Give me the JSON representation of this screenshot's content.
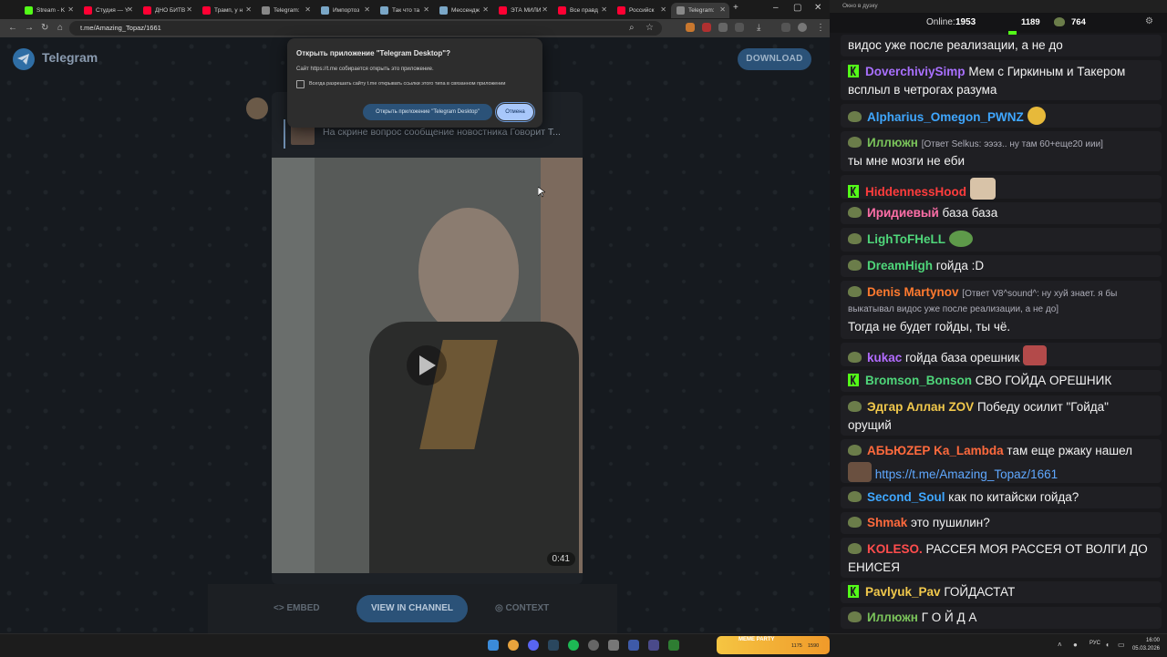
{
  "browser": {
    "tabs": [
      {
        "label": "Stream - K",
        "color": "#53fc18"
      },
      {
        "label": "Студия — Y",
        "color": "#ff0033"
      },
      {
        "label": "ДНО БИТВ",
        "color": "#ff0033"
      },
      {
        "label": "Трамп, у н",
        "color": "#ff0033"
      },
      {
        "label": "Telegram: ",
        "color": "#888888"
      },
      {
        "label": "Импортоз",
        "color": "#7aa7c7"
      },
      {
        "label": "Так что та",
        "color": "#7aa7c7"
      },
      {
        "label": "Мессендж",
        "color": "#7aa7c7"
      },
      {
        "label": "ЭТА МИЛИ",
        "color": "#ff0033"
      },
      {
        "label": "Все правд",
        "color": "#ff0033"
      },
      {
        "label": "Российск",
        "color": "#ff0033"
      },
      {
        "label": "Telegram: ",
        "color": "#888888"
      }
    ],
    "url": "t.me/Amazing_Topaz/1661"
  },
  "telegram": {
    "brand": "Telegram",
    "download_label": "DOWNLOAD",
    "reply_preview": "На скрине вопрос сообщение новостника Говорит Т...",
    "video_duration": "0:41",
    "embed_label": "EMBED",
    "view_label": "VIEW IN CHANNEL",
    "context_label": "CONTEXT"
  },
  "dialog": {
    "title": "Открыть приложение \"Telegram Desktop\"?",
    "body": "Сайт https://t.me собирается открыть это приложение.",
    "checkbox_label": "Всегда разрешать сайту t.me открывать ссылки этого типа в связанном приложении",
    "open_label": "Открыть приложение \"Telegram Desktop\"",
    "cancel_label": "Отмена"
  },
  "chat": {
    "window_title": "Окно в дуэку",
    "online_label": "Online:",
    "online_count": "1953",
    "kick_count": "1189",
    "twitch_count": "764",
    "messages": [
      {
        "badge": "none",
        "nick": "",
        "nick_color": "#ffffff",
        "text": "видос уже после реализации, а не до",
        "text2": ""
      },
      {
        "badge": "kick",
        "nick": "DoverchiviySimp",
        "nick_color": "#a970ff",
        "text": "Мем с Гиркиным и Такером",
        "text2": "всплыл в четрогах разума"
      },
      {
        "badge": "twitch",
        "nick": "Alpharius_Omegon_PWNZ",
        "nick_color": "#3fa7ff",
        "text": "",
        "text2": ""
      },
      {
        "badge": "twitch",
        "nick": "Иллюжн",
        "nick_color": "#7ac35a",
        "reply": "[Ответ Selkus: эээз.. ну там 60+еще20 иии]",
        "text": "",
        "text2": "ты мне мозги не еби"
      },
      {
        "badge": "kick",
        "nick": "HiddennessHood",
        "nick_color": "#ff3c3c",
        "text": "",
        "text2": ""
      },
      {
        "badge": "twitch",
        "nick": "Иридиевый",
        "nick_color": "#ff6fa8",
        "text": "база база",
        "text2": ""
      },
      {
        "badge": "twitch",
        "nick": "LighToFHeLL",
        "nick_color": "#4fd67a",
        "text": "",
        "text2": ""
      },
      {
        "badge": "twitch",
        "nick": "DreamHigh",
        "nick_color": "#4fd67a",
        "text": "гойда :D",
        "text2": ""
      },
      {
        "badge": "twitch",
        "nick": "Denis Martynov",
        "nick_color": "#ff7a2f",
        "reply": "[Ответ V8^sound^: ну хуй знает. я бы",
        "reply2": "выкатывал видос уже после реализации, а не до]",
        "text": "",
        "text2": "Тогда не будет гойды, ты чё."
      },
      {
        "badge": "twitch",
        "nick": "kukac",
        "nick_color": "#b26bff",
        "text": "гойда база орешник",
        "text2": ""
      },
      {
        "badge": "kick",
        "nick": "Bromson_Bonson",
        "nick_color": "#4fd67a",
        "text": "СВО ГОЙДА ОРЕШНИК",
        "text2": ""
      },
      {
        "badge": "twitch",
        "nick": "Эдгар Аллан ZOV",
        "nick_color": "#f2c94c",
        "text": "Победу осилит \"Гойда\"",
        "text2": "орущий"
      },
      {
        "badge": "twitch",
        "nick": "АБЬЮZЕР",
        "nick_color": "#ff6a3d",
        "nick2": "Ka_Lambda",
        "text": "там еще ржаку нашел",
        "text2": "https://t.me/Amazing_Topaz/1661"
      },
      {
        "badge": "twitch",
        "nick": "Second_Soul",
        "nick_color": "#3fa7ff",
        "text": "как по китайски гойда?",
        "text2": ""
      },
      {
        "badge": "twitch",
        "nick": "Shmak",
        "nick_color": "#ff6a3d",
        "text": "это пушилин?",
        "text2": ""
      },
      {
        "badge": "twitch",
        "nick": "KOLESO.",
        "nick_color": "#ff4d4d",
        "text": "РАССЕЯ МОЯ РАССЕЯ ОТ ВОЛГИ ДО",
        "text2": "ЕНИСЕЯ"
      },
      {
        "badge": "kick",
        "nick": "Pavlyuk_Pav",
        "nick_color": "#f2c94c",
        "text": "ГОЙДАСТАТ",
        "text2": ""
      },
      {
        "badge": "twitch",
        "nick": "Иллюжн",
        "nick_color": "#7ac35a",
        "text": "Г О Й Д А",
        "text2": ""
      }
    ]
  },
  "taskbar": {
    "widget_label": "MEME PARTY",
    "widget_a": "1175",
    "widget_b": "1590",
    "lang": "РУС",
    "time": "16:00",
    "date": "05.03.2026"
  }
}
